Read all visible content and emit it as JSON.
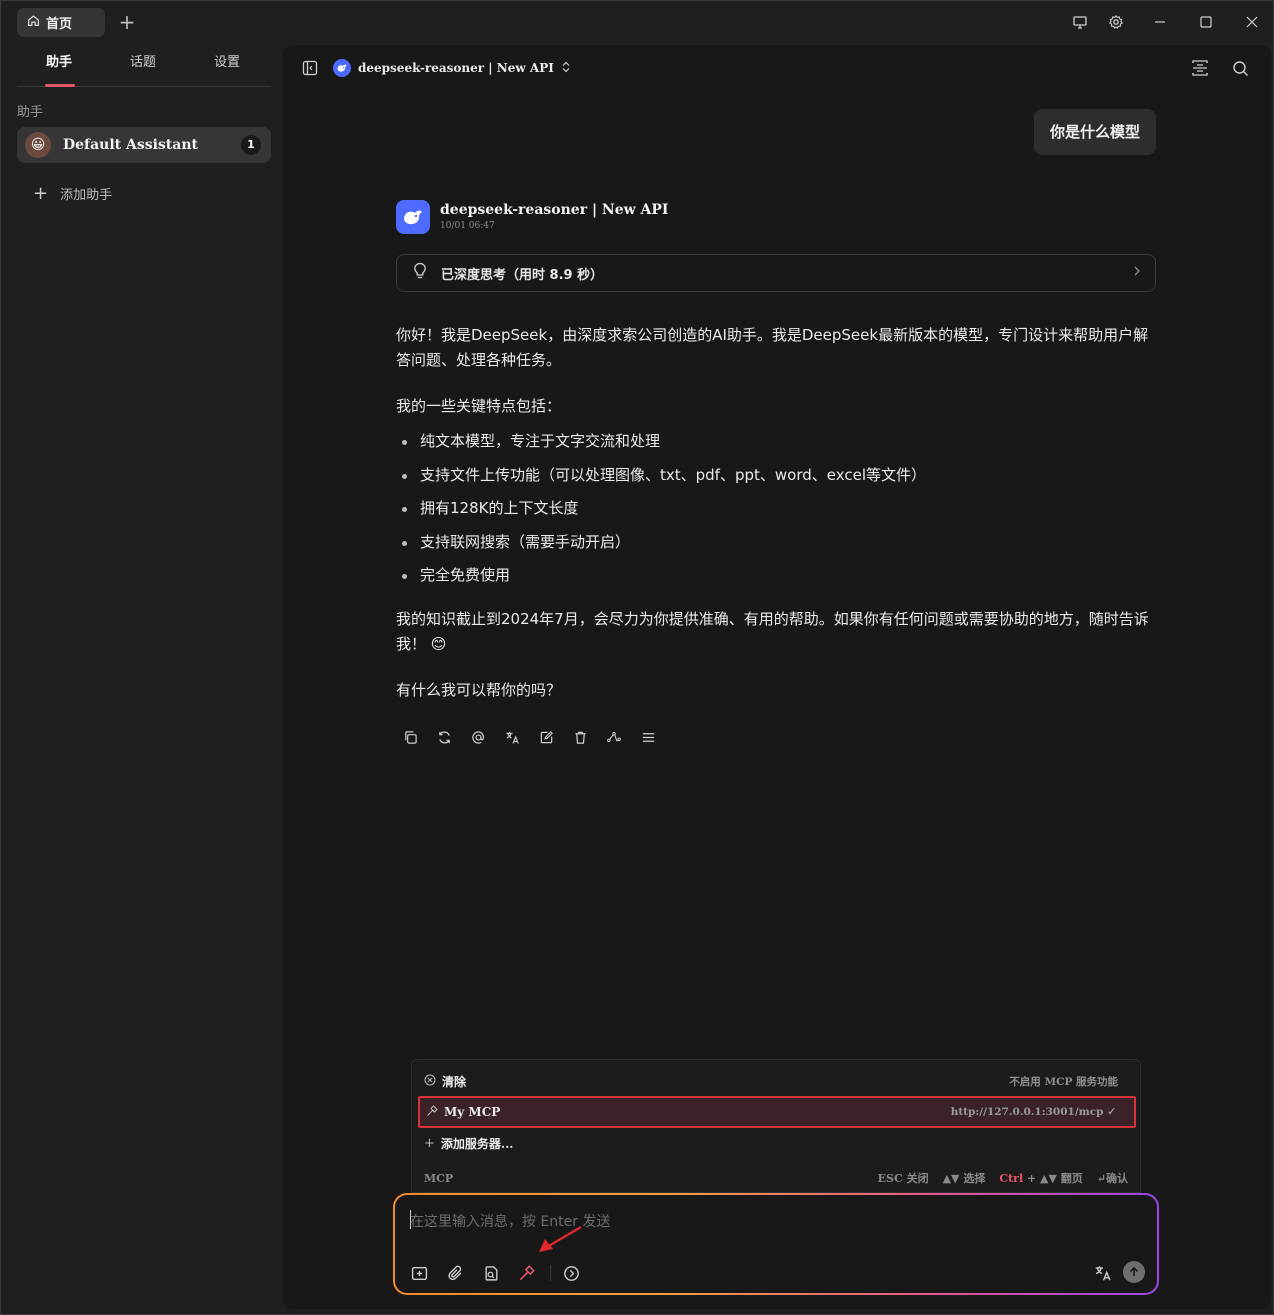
{
  "titlebar": {
    "home_tab_label": "首页",
    "add_tab_glyph": "+",
    "icons": [
      "home-icon",
      "monitor-icon",
      "gear-icon",
      "minimize-icon",
      "maximize-icon",
      "close-icon"
    ]
  },
  "sidebar": {
    "tabs": [
      {
        "label": "助手",
        "active": true
      },
      {
        "label": "话题",
        "active": false
      },
      {
        "label": "设置",
        "active": false
      }
    ],
    "section_title": "助手",
    "assistant": {
      "name": "Default Assistant",
      "count": "1",
      "avatar_emoji": "😀"
    },
    "add_label": "添加助手",
    "accent_color": "#e8566b"
  },
  "topbar": {
    "model_label": "deepseek-reasoner | New API",
    "icons": [
      "sidebar-toggle-icon",
      "chevron-updown-icon",
      "layout-icon",
      "search-icon"
    ]
  },
  "chat": {
    "user_message": "你是什么模型",
    "assistant": {
      "model": "deepseek-reasoner | New API",
      "time": "10/01 06:47",
      "thinking_label": "已深度思考（用时 8.9 秒）",
      "intro": "你好！我是DeepSeek，由深度求索公司创造的AI助手。我是DeepSeek最新版本的模型，专门设计来帮助用户解答问题、处理各种任务。",
      "features_title": "我的一些关键特点包括：",
      "features": [
        "纯文本模型，专注于文字交流和处理",
        "支持文件上传功能（可以处理图像、txt、pdf、ppt、word、excel等文件）",
        "拥有128K的上下文长度",
        "支持联网搜索（需要手动开启）",
        "完全免费使用"
      ],
      "knowledge": "我的知识截止到2024年7月，会尽力为你提供准确、有用的帮助。如果你有任何问题或需要协助的地方，随时告诉我！ 😊",
      "closing": "有什么我可以帮你的吗？"
    },
    "action_icons": [
      "copy-icon",
      "regenerate-icon",
      "mention-icon",
      "translate-icon",
      "edit-icon",
      "delete-icon",
      "branch-icon",
      "menu-icon"
    ]
  },
  "mcp_popup": {
    "clear_label": "清除",
    "clear_hint": "不启用 MCP 服务功能",
    "server_name": "My MCP",
    "server_url": "http://127.0.0.1:3001/mcp",
    "add_server_label": "添加服务器...",
    "footer_title": "MCP",
    "hint_esc": "ESC 关闭",
    "hint_select": "▲▼ 选择",
    "hint_ctrl": "Ctrl",
    "hint_page": "+ ▲▼ 翻页",
    "hint_confirm": "↵确认",
    "highlight_color": "#d8323a"
  },
  "input": {
    "placeholder": "在这里输入消息，按 Enter 发送",
    "tool_icons": [
      "new-topic-icon",
      "attachment-icon",
      "knowledge-icon",
      "mcp-hammer-icon",
      "expand-icon",
      "translate-icon",
      "send-icon"
    ],
    "annotation_color": "#e0262e"
  }
}
